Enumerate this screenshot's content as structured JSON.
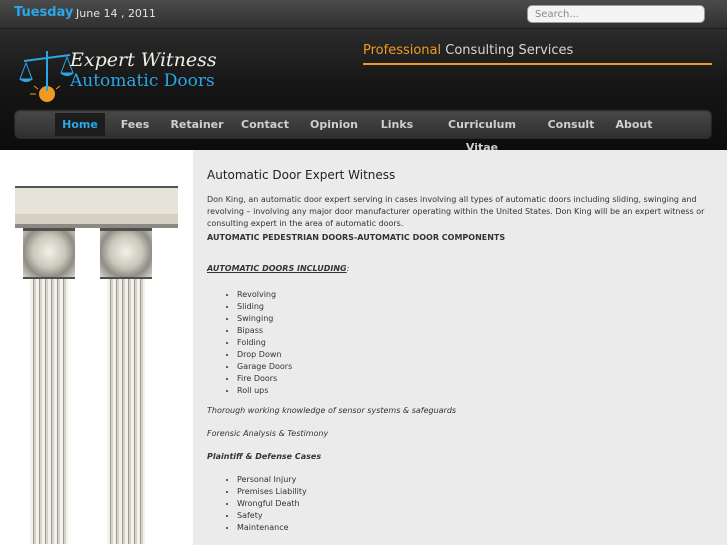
{
  "topbar": {
    "day": "Tuesday",
    "date": "June 14 , 2011",
    "search_placeholder": "Search..."
  },
  "header": {
    "logo_line1": "Expert Witness",
    "logo_line2": "Automatic Doors",
    "tagline_accent": "Professional",
    "tagline_rest": " Consulting Services"
  },
  "nav": {
    "items": [
      "Home",
      "Fees",
      "Retainer",
      "Contact",
      "Opinion",
      "Links",
      "Curriculum Vitae",
      "Consult",
      "About"
    ]
  },
  "content": {
    "title": "Automatic Door Expert Witness",
    "intro": "Don King, an automatic door expert serving in cases involving all types of automatic doors including sliding, swinging and revolving – involving any major door manufacturer operating within the United States. Don King will be an expert witness or consulting expert in the area of automatic doors.",
    "components_heading": "AUTOMATIC PEDESTRIAN DOORS-AUTOMATIC DOOR COMPONENTS",
    "including_heading": "AUTOMATIC DOORS INCLUDING",
    "including_suffix": ":",
    "door_types": [
      "Revolving",
      "Sliding",
      "Swinging",
      "Bipass",
      "Folding",
      "Drop Down",
      "Garage Doors",
      "Fire Doors",
      "Roll ups"
    ],
    "knowledge": "Thorough working knowledge of sensor systems & safeguards",
    "forensic": "Forensic Analysis & Testimony",
    "cases_heading": "Plaintiff & Defense Cases",
    "case_types": [
      "Personal Injury",
      "Premises Liability",
      "Wrongful Death",
      "Safety",
      "Maintenance"
    ]
  },
  "colors": {
    "accent_blue": "#2aa7e6",
    "accent_orange": "#f09a23"
  }
}
